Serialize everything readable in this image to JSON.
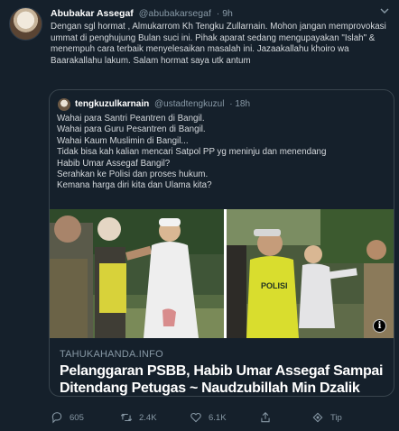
{
  "tweet": {
    "author_name": "Abubakar Assegaf",
    "author_handle": "@abubakarsegaf",
    "time": "· 9h",
    "text": "Dengan sgl hormat , Almukarrom Kh Tengku Zullarnain. Mohon jangan memprovokasi ummat di penghujung Bulan suci ini. Pihak aparat sedang mengupayakan \"Islah\"  & menempuh cara terbaik menyelesaikan masalah ini. Jazaakallahu khoiro wa Baarakallahu lakum. Salam hormat saya utk antum"
  },
  "quoted": {
    "author_name": "tengkuzulkarnain",
    "author_handle": "@ustadtengkuzul",
    "time": "· 18h",
    "lines": [
      "Wahai para Santri Peantren di Bangil.",
      "Wahai para Guru Pesantren di Bangil.",
      "Wahai Kaum Muslimin di Bangil...",
      "Tidak bisa kah kalian mencari Satpol PP yg meninju dan menendang",
      "Habib Umar Assegaf Bangil?",
      "Serahkan ke Polisi dan proses hukum.",
      "Kemana harga diri kita dan Ulama kita?"
    ],
    "card": {
      "source": "TAHUKAHANDA.INFO",
      "title": "Pelanggaran PSBB, Habib Umar Assegaf Sampai Ditendang Petugas ~ Naudzubillah Min Dzalik",
      "vest_text": "POLISI",
      "info_glyph": "i"
    }
  },
  "actions": {
    "replies": "605",
    "retweets": "2.4K",
    "likes": "6.1K",
    "tip": "Tip"
  },
  "icons": {
    "more": "chevron-down-icon",
    "reply": "reply-icon",
    "retweet": "retweet-icon",
    "like": "heart-icon",
    "share": "share-icon",
    "tip": "tip-icon"
  },
  "colors": {
    "background": "#15202b",
    "muted": "#8899a6",
    "border": "#38444d",
    "text": "#d4d8dc"
  }
}
